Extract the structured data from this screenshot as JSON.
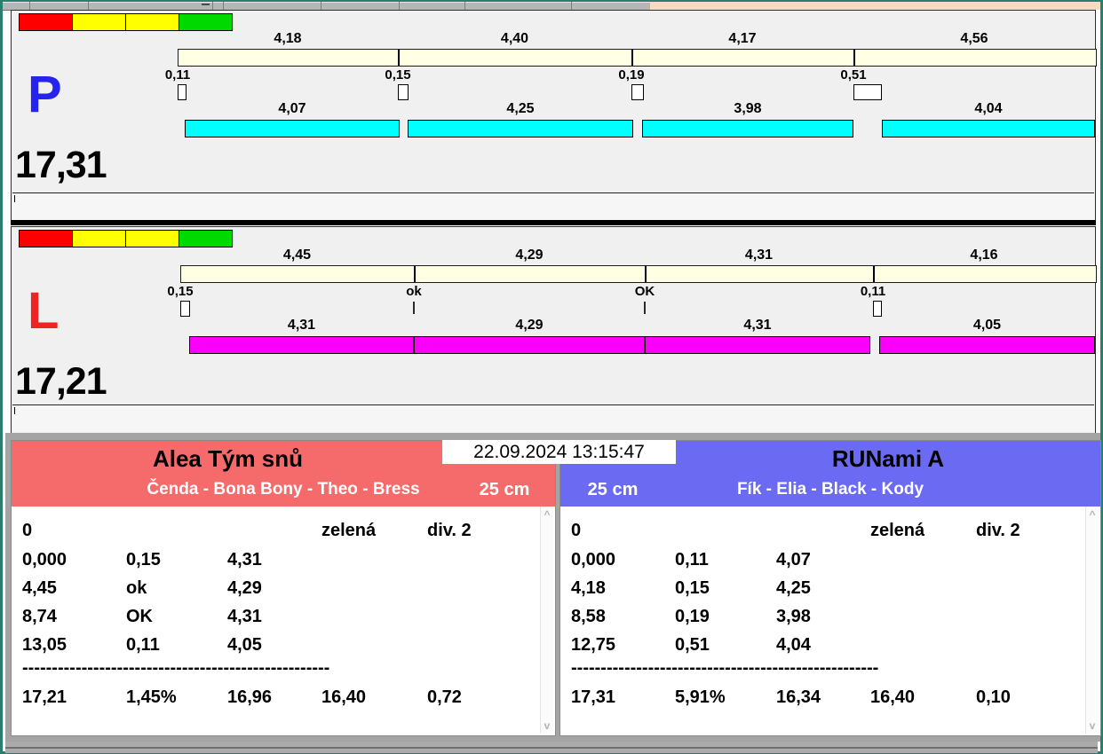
{
  "colors": {
    "window_border": "#2b7d6d",
    "panel_bg": "#f0f0f0",
    "split_bar": "#ffffe3",
    "lane_p_bar": "#00ffff",
    "lane_l_bar": "#fa00fa",
    "team_left_header": "#f56a6a",
    "team_right_header": "#6a6af2",
    "legend": [
      "#fe0000",
      "#ffff00",
      "#ffff00",
      "#00d900"
    ]
  },
  "datetime": "22.09.2024 13:15:47",
  "lanes": [
    {
      "letter": "P",
      "letter_color": "#2424ee",
      "total": "17,31",
      "splits": [
        "4,18",
        "4,40",
        "4,17",
        "4,56"
      ],
      "exchanges": [
        {
          "label": "0,11",
          "marker": "box",
          "w": 8
        },
        {
          "label": "0,15",
          "marker": "box",
          "w": 10
        },
        {
          "label": "0,19",
          "marker": "box",
          "w": 12
        },
        {
          "label": "0,51",
          "marker": "box",
          "w": 30
        }
      ],
      "runs": [
        "4,07",
        "4,25",
        "3,98",
        "4,04"
      ],
      "run_color": "#00ffff",
      "boundaries": [
        197,
        445,
        708,
        958,
        1230
      ],
      "run_segments": [
        [
          205,
          447
        ],
        [
          456,
          710
        ],
        [
          720,
          958
        ],
        [
          990,
          1230
        ]
      ]
    },
    {
      "letter": "L",
      "letter_color": "#ee2424",
      "total": "17,21",
      "splits": [
        "4,45",
        "4,29",
        "4,31",
        "4,16"
      ],
      "exchanges": [
        {
          "label": "0,15",
          "marker": "box",
          "w": 9
        },
        {
          "label": "ok",
          "marker": "tick"
        },
        {
          "label": "OK",
          "marker": "tick"
        },
        {
          "label": "0,11",
          "marker": "box",
          "w": 8
        }
      ],
      "runs": [
        "4,31",
        "4,29",
        "4,31",
        "4,05"
      ],
      "run_color": "#fa00fa",
      "boundaries": [
        200,
        463,
        723,
        980,
        1230
      ],
      "run_segments": [
        [
          210,
          463
        ],
        [
          463,
          723
        ],
        [
          723,
          977
        ],
        [
          987,
          1230
        ]
      ]
    }
  ],
  "teams": [
    {
      "name": "Alea Tým snů",
      "members": "Čenda - Bona Bony - Theo - Bress",
      "distance": "25 cm",
      "header_color": "#f56a6a",
      "rows": [
        [
          "0",
          "",
          "",
          "zelená",
          "div. 2"
        ],
        [
          "0,000",
          "0,15",
          "4,31",
          "",
          ""
        ],
        [
          "4,45",
          "ok",
          "4,29",
          "",
          ""
        ],
        [
          "8,74",
          "OK",
          "4,31",
          "",
          ""
        ],
        [
          "13,05",
          "0,11",
          "4,05",
          "",
          ""
        ]
      ],
      "separator": "----------------------------------------------------",
      "totals": [
        "17,21",
        "1,45%",
        "16,96",
        "16,40",
        "0,72"
      ]
    },
    {
      "name": "RUNami A",
      "members": "Fík - Elia - Black - Kody",
      "distance": "25 cm",
      "header_color": "#6a6af2",
      "rows": [
        [
          "0",
          "",
          "",
          "zelená",
          "div. 2"
        ],
        [
          "0,000",
          "0,11",
          "4,07",
          "",
          ""
        ],
        [
          "4,18",
          "0,15",
          "4,25",
          "",
          ""
        ],
        [
          "8,58",
          "0,19",
          "3,98",
          "",
          ""
        ],
        [
          "12,75",
          "0,51",
          "4,04",
          "",
          ""
        ]
      ],
      "separator": "----------------------------------------------------",
      "totals": [
        "17,31",
        "5,91%",
        "16,34",
        "16,40",
        "0,10"
      ]
    }
  ],
  "scrollbar": {
    "up": "^",
    "down": "v"
  }
}
